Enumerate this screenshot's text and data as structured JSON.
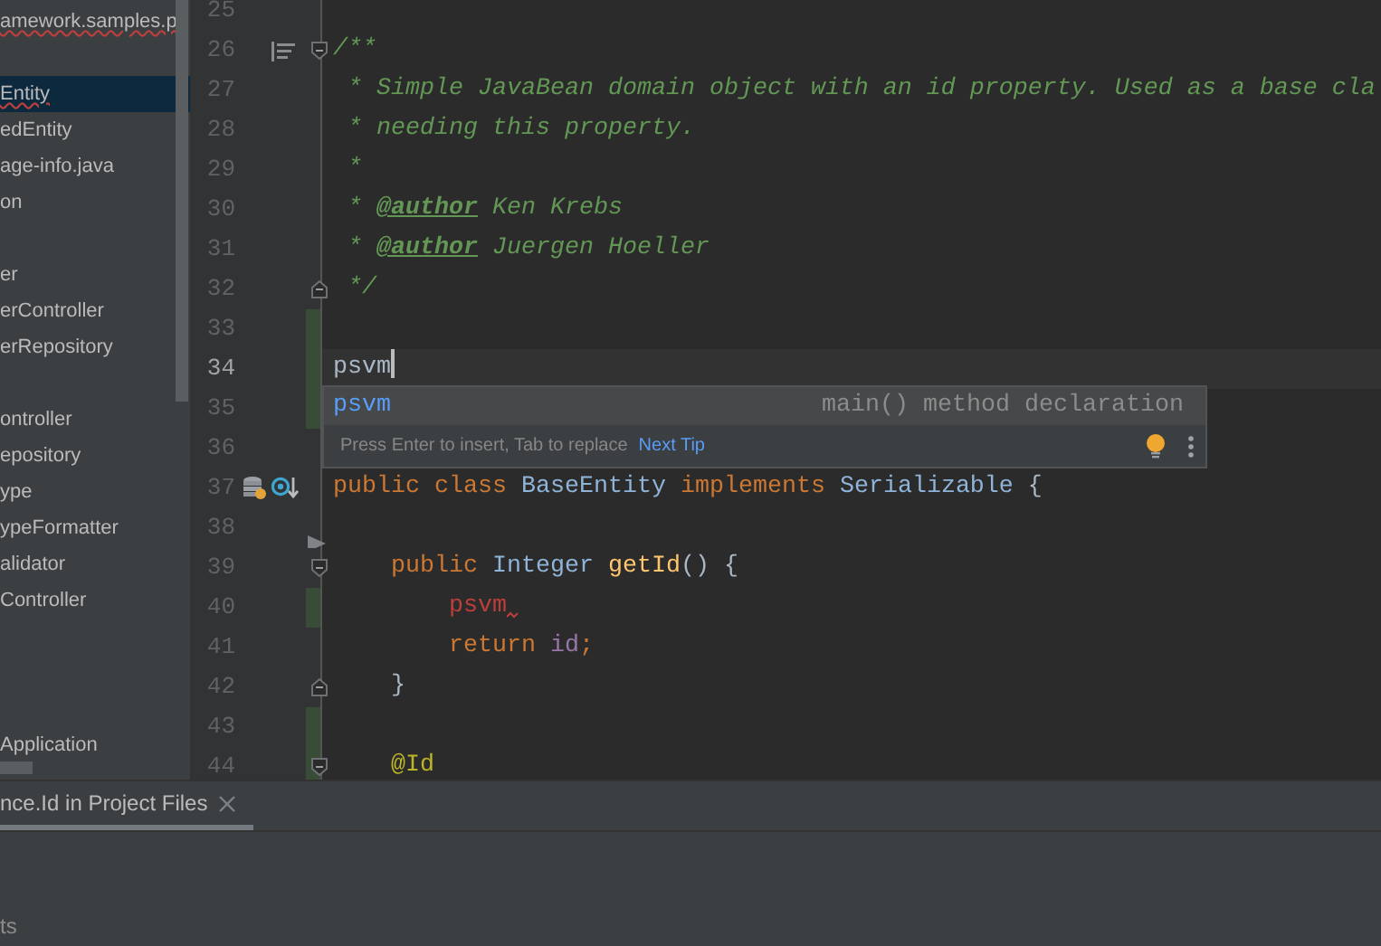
{
  "project_tree": {
    "items": [
      {
        "label": "amework.samples.p",
        "selected": false,
        "error": true
      },
      {
        "label": "Entity",
        "selected": true,
        "error": true
      },
      {
        "label": "edEntity",
        "selected": false
      },
      {
        "label": "age-info.java",
        "selected": false
      },
      {
        "label": "on",
        "selected": false
      },
      {
        "label": "er",
        "selected": false
      },
      {
        "label": "erController",
        "selected": false
      },
      {
        "label": "erRepository",
        "selected": false
      },
      {
        "label": "ontroller",
        "selected": false
      },
      {
        "label": "epository",
        "selected": false
      },
      {
        "label": "ype",
        "selected": false
      },
      {
        "label": "ypeFormatter",
        "selected": false
      },
      {
        "label": "alidator",
        "selected": false
      },
      {
        "label": "Controller",
        "selected": false
      },
      {
        "label": "Application",
        "selected": false
      }
    ]
  },
  "editor": {
    "lines": [
      {
        "number": "25"
      },
      {
        "number": "26",
        "fold_start": true,
        "gutter_icons": [
          {
            "kind": "reader-mode"
          }
        ],
        "tokens": [
          {
            "text": "/**",
            "kind": "comment"
          }
        ]
      },
      {
        "number": "27",
        "tokens": [
          {
            "text": " * Simple JavaBean domain object with an id property. Used as a base cla",
            "kind": "comment"
          }
        ]
      },
      {
        "number": "28",
        "tokens": [
          {
            "text": " * needing this property.",
            "kind": "comment"
          }
        ]
      },
      {
        "number": "29",
        "tokens": [
          {
            "text": " *",
            "kind": "comment"
          }
        ]
      },
      {
        "number": "30",
        "tokens": [
          {
            "text": " * ",
            "kind": "comment"
          },
          {
            "text": "@author",
            "kind": "doc-tag"
          },
          {
            "text": " Ken Krebs",
            "kind": "comment"
          }
        ]
      },
      {
        "number": "31",
        "tokens": [
          {
            "text": " * ",
            "kind": "comment"
          },
          {
            "text": "@author",
            "kind": "doc-tag"
          },
          {
            "text": " Juergen Hoeller",
            "kind": "comment"
          }
        ]
      },
      {
        "number": "32",
        "fold_end": true,
        "tokens": [
          {
            "text": " */",
            "kind": "comment"
          }
        ]
      },
      {
        "number": "33",
        "changed": true
      },
      {
        "number": "34",
        "current": true,
        "changed": true,
        "caret": true,
        "tokens": [
          {
            "text": "psvm",
            "kind": "plain"
          }
        ]
      },
      {
        "number": "35",
        "changed": true
      },
      {
        "number": "36"
      },
      {
        "number": "37",
        "gutter_icons": [
          {
            "kind": "database"
          },
          {
            "kind": "overridden-method"
          }
        ],
        "tokens": [
          {
            "text": "public class ",
            "kind": "keyword"
          },
          {
            "text": "BaseEntity",
            "kind": "type"
          },
          {
            "text": " implements ",
            "kind": "keyword"
          },
          {
            "text": "Serializable",
            "kind": "type"
          },
          {
            "text": " {",
            "kind": "plain"
          }
        ]
      },
      {
        "number": "38",
        "gutter_icons": [
          {
            "kind": "run"
          }
        ]
      },
      {
        "number": "39",
        "fold_start": true,
        "tokens": [
          {
            "text": "    public ",
            "kind": "keyword"
          },
          {
            "text": "Integer ",
            "kind": "type"
          },
          {
            "text": "getId",
            "kind": "method"
          },
          {
            "text": "() {",
            "kind": "plain"
          }
        ]
      },
      {
        "number": "40",
        "changed": true,
        "tokens": [
          {
            "text": "        psvm",
            "kind": "error"
          }
        ]
      },
      {
        "number": "41",
        "tokens": [
          {
            "text": "        return ",
            "kind": "keyword"
          },
          {
            "text": "id",
            "kind": "field"
          },
          {
            "text": ";",
            "kind": "keyword"
          }
        ]
      },
      {
        "number": "42",
        "fold_end": true,
        "tokens": [
          {
            "text": "    }",
            "kind": "plain"
          }
        ]
      },
      {
        "number": "43",
        "changed": true
      },
      {
        "number": "44",
        "changed": true,
        "fold_start": true,
        "tokens": [
          {
            "text": "    @Id",
            "kind": "annotation"
          }
        ]
      }
    ]
  },
  "completion_popup": {
    "items": [
      {
        "name": "psvm",
        "description": "main() method declaration",
        "selected": true
      }
    ],
    "hint": "Press Enter to insert, Tab to replace",
    "hint_link": "Next Tip"
  },
  "bottom_panel": {
    "tabs": [
      {
        "label": "nce.Id in Project Files",
        "selected": true
      }
    ],
    "footer": "ts"
  }
}
